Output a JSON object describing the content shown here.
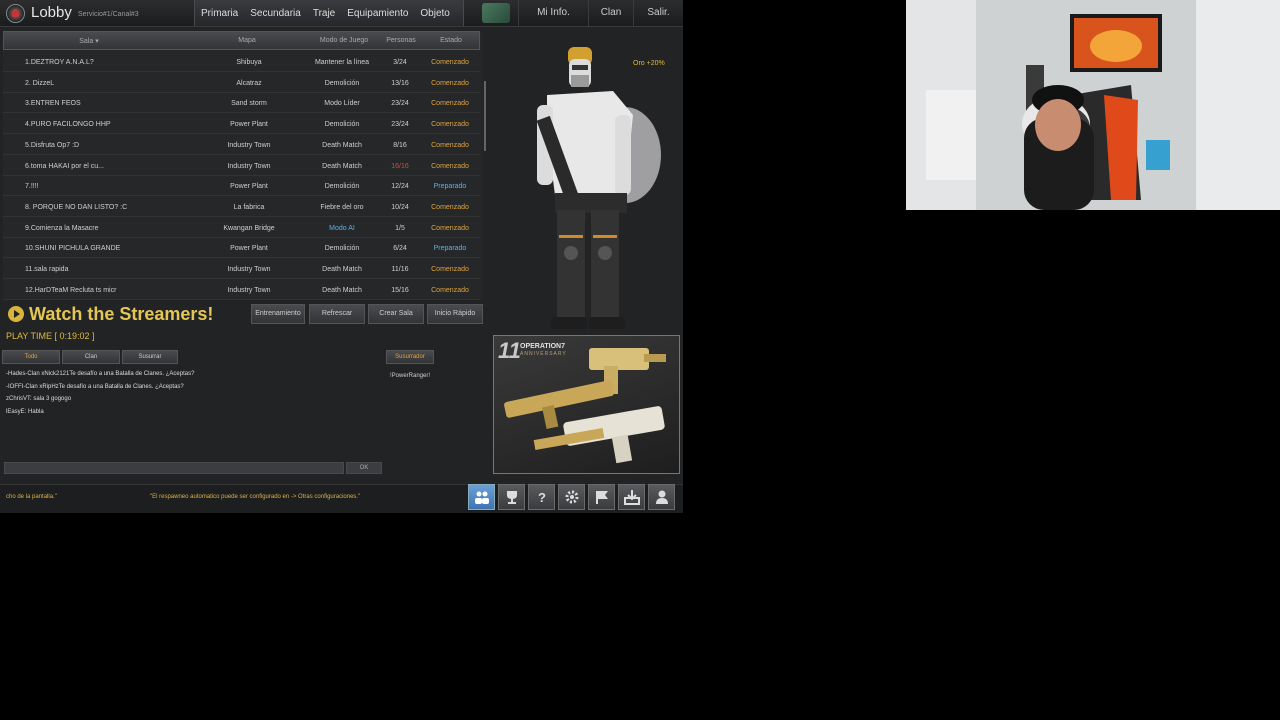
{
  "window": {
    "title": "Lobby",
    "server": "Servicio#1/Canal#3"
  },
  "nav": {
    "main": [
      "Primaria",
      "Secundaria",
      "Traje",
      "Equipamiento",
      "Objeto"
    ],
    "right": [
      "Mi Info.",
      "Clan",
      "Salir."
    ]
  },
  "table": {
    "headers": {
      "room": "Sala ▾",
      "map": "Mapa",
      "mode": "Modo de Juego",
      "players": "Personas",
      "state": "Estado"
    },
    "rows": [
      {
        "name": "1.DEZTROY A.N.A.L?",
        "map": "Shibuya",
        "mode": "Mantener la línea",
        "players": "3/24",
        "state": "Comenzado"
      },
      {
        "name": "2.               DizzeL",
        "map": "Alcatraz",
        "mode": "Demolición",
        "players": "13/16",
        "state": "Comenzado"
      },
      {
        "name": "3.ENTREN FEOS",
        "map": "Sand storm",
        "mode": "Modo Líder",
        "players": "23/24",
        "state": "Comenzado"
      },
      {
        "name": "4.PURO FACILONGO HHP",
        "map": "Power Plant",
        "mode": "Demolición",
        "players": "23/24",
        "state": "Comenzado"
      },
      {
        "name": "5.Disfruta Op7 :D",
        "map": "Industry Town",
        "mode": "Death Match",
        "players": "8/16",
        "state": "Comenzado"
      },
      {
        "name": "6.toma HAKAI por el cu...",
        "map": "Industry Town",
        "mode": "Death Match",
        "players": "16/16",
        "state": "Comenzado"
      },
      {
        "name": "7.!!!!",
        "map": "Power Plant",
        "mode": "Demolición",
        "players": "12/24",
        "state": "Preparado"
      },
      {
        "name": "8. PORQUE NO DAN LISTO? :C",
        "map": "La fabrica",
        "mode": "Fiebre del oro",
        "players": "10/24",
        "state": "Comenzado"
      },
      {
        "name": "9.Comienza la Masacre",
        "map": "Kwangan Bridge",
        "mode": "Modo AI",
        "players": "1/5",
        "state": "Comenzado"
      },
      {
        "name": "10.SHUNI PICHULA GRANDE",
        "map": "Power Plant",
        "mode": "Demolición",
        "players": "6/24",
        "state": "Preparado"
      },
      {
        "name": "11.sala rapida",
        "map": "Industry Town",
        "mode": "Death Match",
        "players": "11/16",
        "state": "Comenzado"
      },
      {
        "name": "12.HarDTeaM Recluta ts micr",
        "map": "Industry Town",
        "mode": "Death Match",
        "players": "15/16",
        "state": "Comenzado"
      }
    ]
  },
  "watch": {
    "label": "Watch the Streamers!",
    "playtime": "PLAY TIME [ 0:19:02 ]"
  },
  "room_buttons": [
    "Entrenamiento",
    "Refrescar",
    "Crear Sala",
    "Inicio Rápido"
  ],
  "chat": {
    "tabs": [
      "Todo",
      "Clan",
      "Susurrar"
    ],
    "whisper_tab": "Susurrador",
    "whisper_target": "!PowerRanger!",
    "lines": [
      "-Hades-Clan xNick2121Te desafío a una Batalla de Clanes. ¿Aceptas?",
      "-IOFFI-Clan xRipHzTe desafío a una Batalla de Clanes. ¿Aceptas?",
      "zChrisVT: sala 3 gogogo",
      "lEasyE: Habla"
    ],
    "input_value": "",
    "ok_label": "OK"
  },
  "ticker": {
    "left": "cho de la pantalla.\"",
    "main": "\"El respawneo automatico puede ser configurado en -> Otras configuraciones.\""
  },
  "character": {
    "bonus": "Oro +20%"
  },
  "promo": {
    "number": "11",
    "brand": "OPERATION7",
    "sub": "ANNIVERSARY"
  },
  "toolbar": [
    "friends-icon",
    "trophy-icon",
    "help-icon",
    "gear-icon",
    "flag-icon",
    "download-icon",
    "profile-icon"
  ],
  "colors": {
    "accent_gold": "#e0b93e",
    "started_orange": "#e0a33a",
    "ready_blue": "#59b3e6",
    "full_red": "#d24a3a"
  }
}
